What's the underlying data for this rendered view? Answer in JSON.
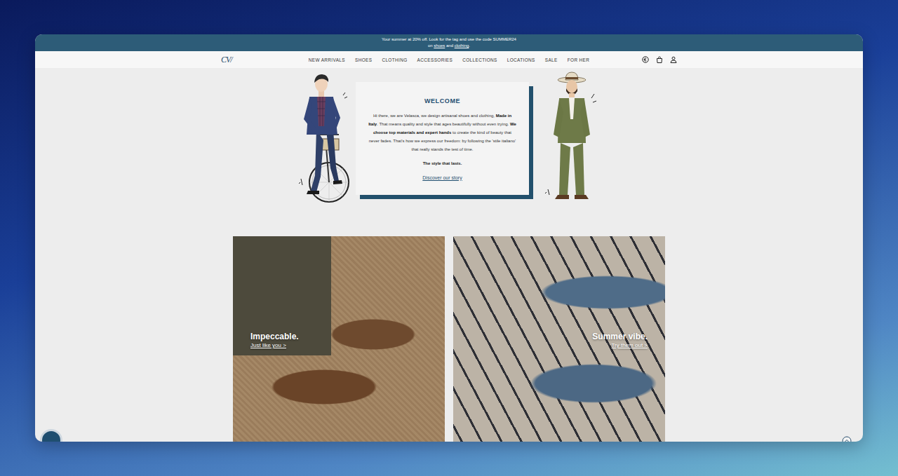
{
  "announcement": {
    "line1": "Your summer at 20% off. Look for the tag and use the code SUMMER24",
    "prefix": "on ",
    "link1": "shoes",
    "between": " and ",
    "link2": "clothing",
    "end": "."
  },
  "nav": {
    "logo": "CV/",
    "items": [
      "NEW ARRIVALS",
      "SHOES",
      "CLOTHING",
      "ACCESSORIES",
      "COLLECTIONS",
      "LOCATIONS",
      "SALE",
      "FOR HER"
    ]
  },
  "welcome": {
    "title": "WELCOME",
    "paragraph": [
      {
        "text": "Hi there, we are Velasca, we design artisanal shoes and clothing, ",
        "bold": false
      },
      {
        "text": "Made in Italy",
        "bold": true
      },
      {
        "text": ". That means quality and style that ages beautifully without even trying. ",
        "bold": false
      },
      {
        "text": "We choose top materials and expert hands",
        "bold": true
      },
      {
        "text": " to create the kind of beauty that never fades. That's how we express our freedom: by following the 'stile italiano' that really stands the test of time.",
        "bold": false
      }
    ],
    "tagline": "The style that lasts.",
    "link": "Discover our story"
  },
  "promos": [
    {
      "title": "Impeccable.",
      "link": "Just like you >",
      "kind": "left"
    },
    {
      "title": "Summer vibe.",
      "link": "Try them out >",
      "kind": "right"
    }
  ]
}
